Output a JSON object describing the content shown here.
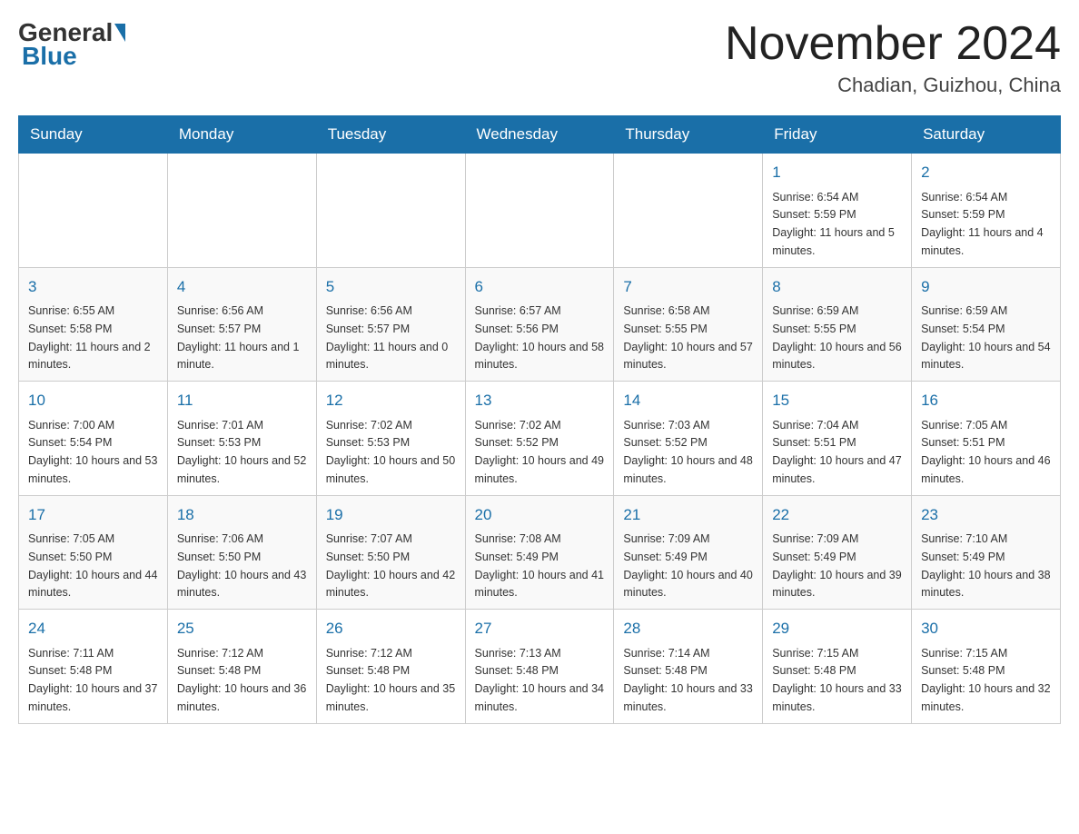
{
  "header": {
    "logo": {
      "general": "General",
      "blue": "Blue"
    },
    "title": "November 2024",
    "location": "Chadian, Guizhou, China"
  },
  "days_of_week": [
    "Sunday",
    "Monday",
    "Tuesday",
    "Wednesday",
    "Thursday",
    "Friday",
    "Saturday"
  ],
  "weeks": [
    [
      {
        "day": "",
        "info": ""
      },
      {
        "day": "",
        "info": ""
      },
      {
        "day": "",
        "info": ""
      },
      {
        "day": "",
        "info": ""
      },
      {
        "day": "",
        "info": ""
      },
      {
        "day": "1",
        "info": "Sunrise: 6:54 AM\nSunset: 5:59 PM\nDaylight: 11 hours and 5 minutes."
      },
      {
        "day": "2",
        "info": "Sunrise: 6:54 AM\nSunset: 5:59 PM\nDaylight: 11 hours and 4 minutes."
      }
    ],
    [
      {
        "day": "3",
        "info": "Sunrise: 6:55 AM\nSunset: 5:58 PM\nDaylight: 11 hours and 2 minutes."
      },
      {
        "day": "4",
        "info": "Sunrise: 6:56 AM\nSunset: 5:57 PM\nDaylight: 11 hours and 1 minute."
      },
      {
        "day": "5",
        "info": "Sunrise: 6:56 AM\nSunset: 5:57 PM\nDaylight: 11 hours and 0 minutes."
      },
      {
        "day": "6",
        "info": "Sunrise: 6:57 AM\nSunset: 5:56 PM\nDaylight: 10 hours and 58 minutes."
      },
      {
        "day": "7",
        "info": "Sunrise: 6:58 AM\nSunset: 5:55 PM\nDaylight: 10 hours and 57 minutes."
      },
      {
        "day": "8",
        "info": "Sunrise: 6:59 AM\nSunset: 5:55 PM\nDaylight: 10 hours and 56 minutes."
      },
      {
        "day": "9",
        "info": "Sunrise: 6:59 AM\nSunset: 5:54 PM\nDaylight: 10 hours and 54 minutes."
      }
    ],
    [
      {
        "day": "10",
        "info": "Sunrise: 7:00 AM\nSunset: 5:54 PM\nDaylight: 10 hours and 53 minutes."
      },
      {
        "day": "11",
        "info": "Sunrise: 7:01 AM\nSunset: 5:53 PM\nDaylight: 10 hours and 52 minutes."
      },
      {
        "day": "12",
        "info": "Sunrise: 7:02 AM\nSunset: 5:53 PM\nDaylight: 10 hours and 50 minutes."
      },
      {
        "day": "13",
        "info": "Sunrise: 7:02 AM\nSunset: 5:52 PM\nDaylight: 10 hours and 49 minutes."
      },
      {
        "day": "14",
        "info": "Sunrise: 7:03 AM\nSunset: 5:52 PM\nDaylight: 10 hours and 48 minutes."
      },
      {
        "day": "15",
        "info": "Sunrise: 7:04 AM\nSunset: 5:51 PM\nDaylight: 10 hours and 47 minutes."
      },
      {
        "day": "16",
        "info": "Sunrise: 7:05 AM\nSunset: 5:51 PM\nDaylight: 10 hours and 46 minutes."
      }
    ],
    [
      {
        "day": "17",
        "info": "Sunrise: 7:05 AM\nSunset: 5:50 PM\nDaylight: 10 hours and 44 minutes."
      },
      {
        "day": "18",
        "info": "Sunrise: 7:06 AM\nSunset: 5:50 PM\nDaylight: 10 hours and 43 minutes."
      },
      {
        "day": "19",
        "info": "Sunrise: 7:07 AM\nSunset: 5:50 PM\nDaylight: 10 hours and 42 minutes."
      },
      {
        "day": "20",
        "info": "Sunrise: 7:08 AM\nSunset: 5:49 PM\nDaylight: 10 hours and 41 minutes."
      },
      {
        "day": "21",
        "info": "Sunrise: 7:09 AM\nSunset: 5:49 PM\nDaylight: 10 hours and 40 minutes."
      },
      {
        "day": "22",
        "info": "Sunrise: 7:09 AM\nSunset: 5:49 PM\nDaylight: 10 hours and 39 minutes."
      },
      {
        "day": "23",
        "info": "Sunrise: 7:10 AM\nSunset: 5:49 PM\nDaylight: 10 hours and 38 minutes."
      }
    ],
    [
      {
        "day": "24",
        "info": "Sunrise: 7:11 AM\nSunset: 5:48 PM\nDaylight: 10 hours and 37 minutes."
      },
      {
        "day": "25",
        "info": "Sunrise: 7:12 AM\nSunset: 5:48 PM\nDaylight: 10 hours and 36 minutes."
      },
      {
        "day": "26",
        "info": "Sunrise: 7:12 AM\nSunset: 5:48 PM\nDaylight: 10 hours and 35 minutes."
      },
      {
        "day": "27",
        "info": "Sunrise: 7:13 AM\nSunset: 5:48 PM\nDaylight: 10 hours and 34 minutes."
      },
      {
        "day": "28",
        "info": "Sunrise: 7:14 AM\nSunset: 5:48 PM\nDaylight: 10 hours and 33 minutes."
      },
      {
        "day": "29",
        "info": "Sunrise: 7:15 AM\nSunset: 5:48 PM\nDaylight: 10 hours and 33 minutes."
      },
      {
        "day": "30",
        "info": "Sunrise: 7:15 AM\nSunset: 5:48 PM\nDaylight: 10 hours and 32 minutes."
      }
    ]
  ]
}
